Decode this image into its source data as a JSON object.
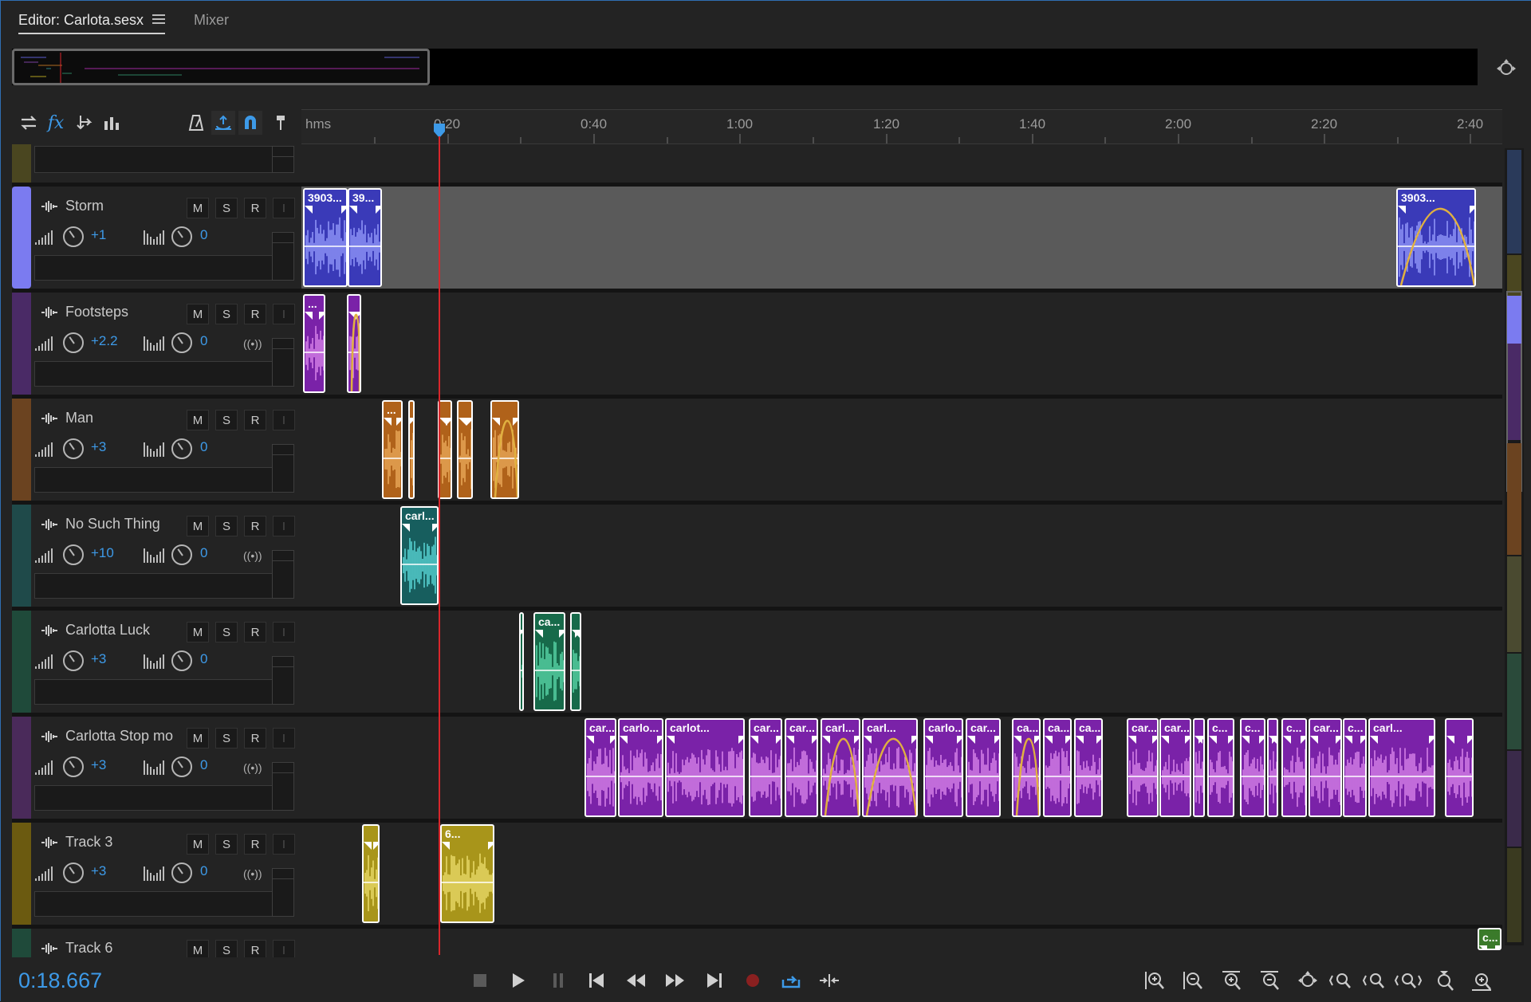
{
  "tabs": {
    "editor": "Editor: Carlota.sesx",
    "mixer": "Mixer"
  },
  "ruler": {
    "unit": "hms",
    "labels": [
      "0:20",
      "0:40",
      "1:00",
      "1:20",
      "1:40",
      "2:00",
      "2:20",
      "2:40"
    ]
  },
  "tracks": [
    {
      "name": "Storm",
      "color": "#7b7bf0",
      "volume": "+1",
      "pan": "0"
    },
    {
      "name": "Footsteps",
      "color": "#4a2a66",
      "volume": "+2.2",
      "pan": "0"
    },
    {
      "name": "Man",
      "color": "#6b4320",
      "volume": "+3",
      "pan": "0"
    },
    {
      "name": "No Such Thing",
      "color": "#1f4a4a",
      "volume": "+10",
      "pan": "0"
    },
    {
      "name": "Carlotta Luck",
      "color": "#1f4a3a",
      "volume": "+3",
      "pan": "0"
    },
    {
      "name": "Carlotta Stop mo",
      "color": "#4a2a5a",
      "volume": "+3",
      "pan": "0"
    },
    {
      "name": "Track 3",
      "color": "#6b5a10",
      "volume": "+3",
      "pan": "0"
    },
    {
      "name": "Track 6",
      "color": "#1f4a3a",
      "volume": "",
      "pan": ""
    }
  ],
  "buttons": {
    "mute": "M",
    "solo": "S",
    "record": "R",
    "input": "I",
    "stereo": "((•))"
  },
  "clips": {
    "storm": [
      "3903...",
      "39...",
      "3903..."
    ],
    "no_such_thing": [
      "carl..."
    ],
    "carlotta_luck": [
      "ca..."
    ],
    "stop_mo": [
      "car...",
      "carlo...",
      "carlot...",
      "car...",
      "car...",
      "carl...",
      "carl...",
      "carlo...",
      "car...",
      "ca...",
      "ca...",
      "ca...",
      "car...",
      "car...",
      "c...",
      "c...",
      "c...",
      "car...",
      "c...",
      "carl..."
    ],
    "track3": [
      "6..."
    ],
    "track6": [
      "c..."
    ],
    "man": [
      "..."
    ],
    "footsteps": [
      "..."
    ]
  },
  "timecode": "0:18.667"
}
